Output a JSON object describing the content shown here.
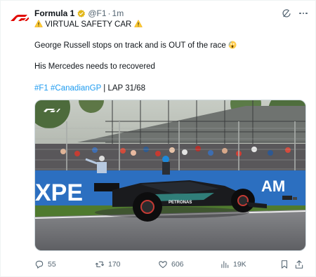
{
  "account": {
    "name": "Formula 1",
    "handle": "@F1",
    "separator": "·",
    "time": "1m"
  },
  "tweet": {
    "line1_text": "VIRTUAL SAFETY CAR",
    "line2_text": "George Russell stops on track and is OUT of the race",
    "line3_text": "His Mercedes needs to recovered",
    "hashtag_f1": "#F1",
    "hashtag_gp": "#CanadianGP",
    "lap_text": "| LAP 31/68"
  },
  "media": {
    "banner_left": "XPE",
    "banner_right": "AM",
    "car_sponsor": "PETRONAS"
  },
  "actions": {
    "replies": "55",
    "reposts": "170",
    "likes": "606",
    "views": "19K"
  },
  "colors": {
    "link": "#1d9bf0",
    "f1_red": "#e10600",
    "verified_gold": "#e2b719",
    "secondary_text": "#536471"
  },
  "icons": [
    "f1-logo-icon",
    "verified-badge-icon",
    "grok-icon",
    "more-icon",
    "warning-icon",
    "scream-emoji-icon",
    "reply-icon",
    "repost-icon",
    "like-icon",
    "views-icon",
    "bookmark-icon",
    "share-icon"
  ]
}
